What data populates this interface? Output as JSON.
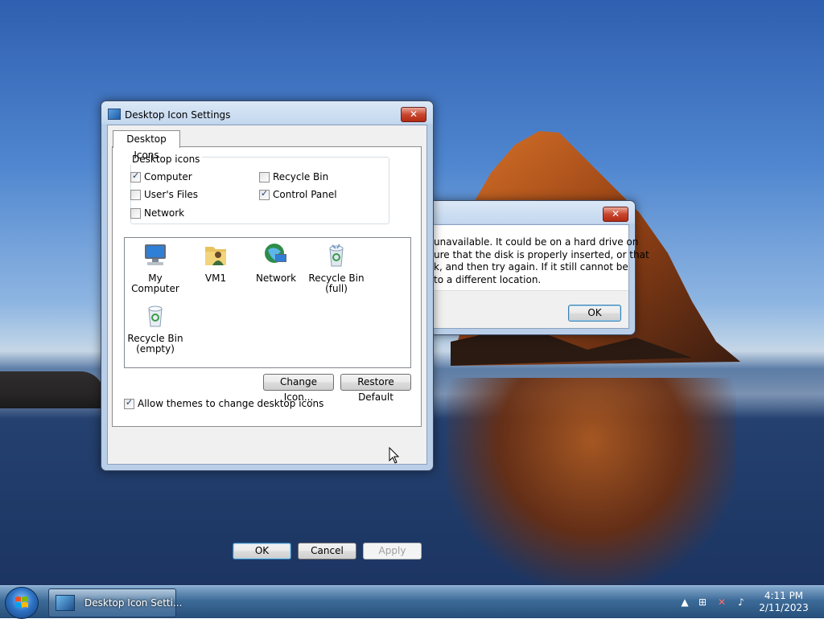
{
  "main_dialog": {
    "title": "Desktop Icon Settings",
    "tab": "Desktop Icons",
    "group_title": "Desktop icons",
    "checkboxes": [
      {
        "label": "Computer",
        "checked": true
      },
      {
        "label": "User's Files",
        "checked": false
      },
      {
        "label": "Network",
        "checked": false
      },
      {
        "label": "Recycle Bin",
        "checked": false
      },
      {
        "label": "Control Panel",
        "checked": true
      }
    ],
    "icons": [
      {
        "label": "My Computer",
        "icon": "computer-icon"
      },
      {
        "label": "VM1",
        "icon": "user-folder-icon"
      },
      {
        "label": "Network",
        "icon": "network-icon"
      },
      {
        "label": "Recycle Bin\n(full)",
        "icon": "recycle-bin-full-icon"
      },
      {
        "label": "Recycle Bin\n(empty)",
        "icon": "recycle-bin-empty-icon"
      }
    ],
    "change_icon_label": "Change Icon...",
    "restore_default_label": "Restore Default",
    "allow_themes_label": "Allow themes to change desktop icons",
    "allow_themes_checked": true,
    "ok_label": "OK",
    "cancel_label": "Cancel",
    "apply_label": "Apply"
  },
  "error_dialog": {
    "lines": [
      "unavailable. It could be on a hard drive on",
      "ure that the disk is properly inserted, or that",
      "k, and then try again. If it still cannot be",
      "to a different location."
    ],
    "ok_label": "OK"
  },
  "taskbar": {
    "task_label": "Desktop Icon Setti...",
    "time": "4:11 PM",
    "date": "2/11/2023"
  },
  "colors": {
    "accent": "#3c7fb1",
    "taskbar": "#264f7a"
  }
}
